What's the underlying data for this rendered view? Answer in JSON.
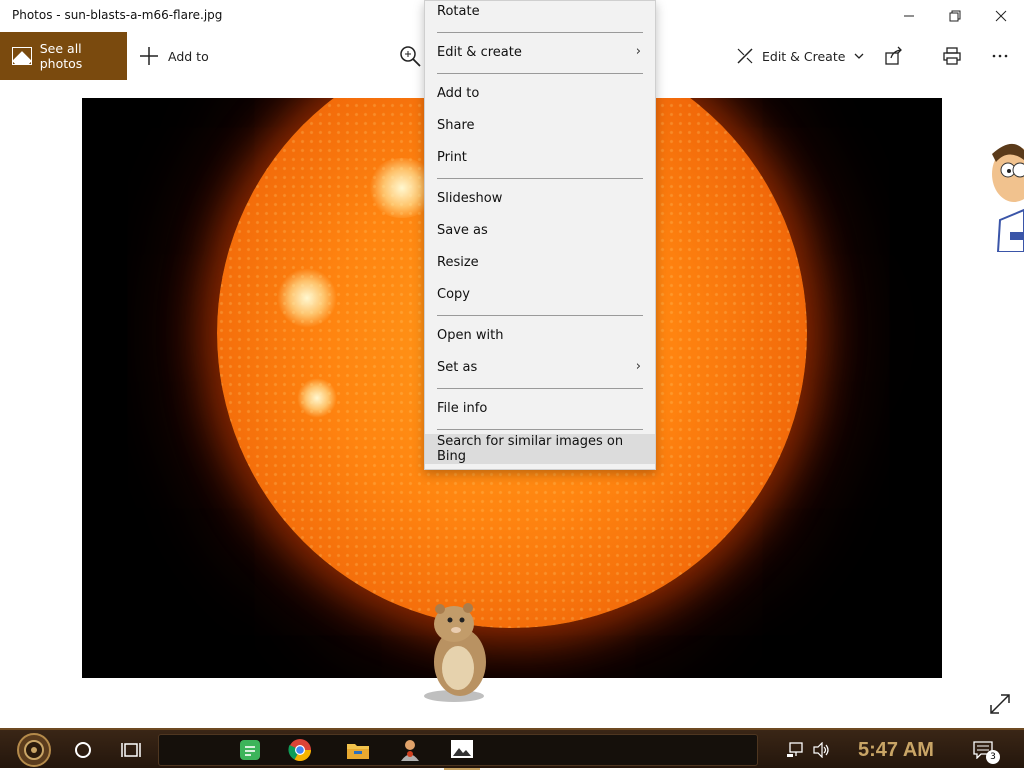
{
  "window": {
    "title": "Photos - sun-blasts-a-m66-flare.jpg",
    "minimize_icon": "minimize-icon",
    "restore_icon": "restore-icon",
    "close_icon": "close-icon"
  },
  "toolbar": {
    "see_all_label": "See all photos",
    "add_to_label": "Add to",
    "edit_create_label": "Edit & Create",
    "icons": [
      "zoom-icon",
      "edit-icon",
      "share-icon",
      "print-icon",
      "more-icon"
    ]
  },
  "context_menu": {
    "items": [
      {
        "label": "Rotate"
      },
      {
        "label": "Edit & create",
        "submenu": true
      },
      {
        "label": "Add to"
      },
      {
        "label": "Share"
      },
      {
        "label": "Print"
      },
      {
        "label": "Slideshow"
      },
      {
        "label": "Save as"
      },
      {
        "label": "Resize"
      },
      {
        "label": "Copy"
      },
      {
        "label": "Open with"
      },
      {
        "label": "Set as",
        "submenu": true
      },
      {
        "label": "File info"
      },
      {
        "label": "Search for similar images on Bing",
        "highlighted": true
      }
    ]
  },
  "taskbar": {
    "clock": "5:47 AM",
    "notification_count": "3",
    "apps": [
      "start-icon",
      "cortana-icon",
      "task-view-icon",
      "notes-app-icon",
      "chrome-icon",
      "file-explorer-icon",
      "person-app-icon",
      "photos-app-icon"
    ],
    "tray": [
      "network-icon",
      "volume-icon",
      "notifications-icon"
    ]
  },
  "colors": {
    "accent": "#7a4a0e",
    "menu_bg": "#f2f2f2",
    "clock": "#c9a566",
    "taskbar": "#2e1d10"
  }
}
